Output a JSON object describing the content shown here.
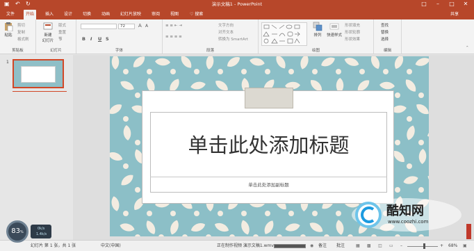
{
  "window": {
    "title": "演示文稿1 - PowerPoint"
  },
  "quick_access": {
    "save_icon": "save-icon",
    "undo_icon": "undo-icon",
    "redo_icon": "redo-icon"
  },
  "tabs": [
    {
      "label": "文件",
      "active": false
    },
    {
      "label": "开始",
      "active": true
    },
    {
      "label": "插入",
      "active": false
    },
    {
      "label": "设计",
      "active": false
    },
    {
      "label": "切换",
      "active": false
    },
    {
      "label": "动画",
      "active": false
    },
    {
      "label": "幻灯片放映",
      "active": false
    },
    {
      "label": "审阅",
      "active": false
    },
    {
      "label": "视图",
      "active": false
    }
  ],
  "search_label": "♡ 搜索",
  "share_label": "共享",
  "ribbon": {
    "clipboard": {
      "paste": "粘贴",
      "cut": "剪切",
      "copy": "复制",
      "format": "格式刷",
      "group": "剪贴板"
    },
    "slides": {
      "new_slide_line1": "新建",
      "new_slide_line2": "幻灯片",
      "layout": "版式",
      "reset": "重置",
      "section": "节",
      "group": "幻灯片"
    },
    "font": {
      "font_size": "72",
      "group": "字体",
      "bold": "B",
      "italic": "I",
      "underline": "U",
      "strike": "S",
      "grow": "A",
      "shrink": "A"
    },
    "paragraph": {
      "text_direction": "文字方向",
      "align_text": "对齐文本",
      "smartart": "转换为 SmartArt",
      "group": "段落"
    },
    "drawing": {
      "arrange": "排列",
      "quick_styles": "快速样式",
      "fill": "形状填充",
      "outline": "形状轮廓",
      "effects": "形状效果",
      "group": "绘图"
    },
    "editing": {
      "find": "查找",
      "replace": "替换",
      "select": "选择",
      "group": "编辑"
    }
  },
  "slide_panel": {
    "number": "1"
  },
  "slide": {
    "title_placeholder": "单击此处添加标题",
    "subtitle_placeholder": "单击此处添加副标题"
  },
  "status": {
    "slide_info": "幻灯片 第 1 张，共 1 张",
    "language": "中文(中国)",
    "recording": "正在制作视频 演示文稿1.wmv",
    "notes": "备注",
    "comments": "批注",
    "zoom": "68%"
  },
  "overlay": {
    "gauge_value": "83",
    "gauge_unit": "%",
    "widget_line1": "0k/s",
    "widget_line2": "1.4k/s",
    "watermark_brand": "酷知网",
    "watermark_url": "www.coozhi.com"
  },
  "colors": {
    "accent": "#b7472a",
    "slide_bg": "#8cbfc7",
    "pattern": "#f3ece1"
  }
}
